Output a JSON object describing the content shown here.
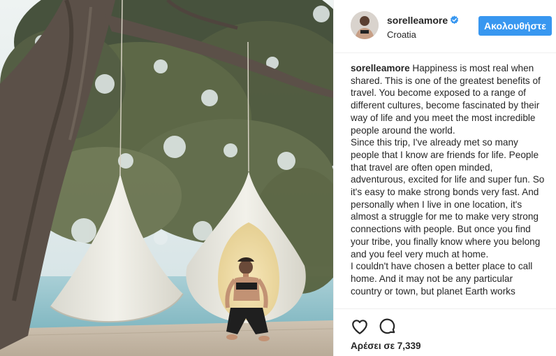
{
  "post": {
    "username": "sorelleamore",
    "location": "Croatia",
    "follow_label": "Ακολουθήστε",
    "caption_username": "sorelleamore",
    "caption_paragraphs": [
      "Happiness is most real when shared. This is one of the greatest benefits of travel. You become exposed to a range of different cultures, become fascinated by their way of life and you meet the most incredible people around the world.",
      "Since this trip, I've already met so many people that I know are friends for life. People that travel are often open minded, adventurous, excited for life and super fun. So it's easy to make strong bonds very fast. And personally when I live in one location, it's almost a struggle for me to make very strong connections with people. But once you find your tribe, you finally know where you belong and you feel very much at home.",
      "I couldn't have chosen a better place to call home. And it may not be any particular country or town, but planet Earth works"
    ],
    "likes_text": "Αρέσει σε 7,339"
  },
  "icons": {
    "verified": "verified-badge-icon",
    "like": "heart-icon",
    "comment": "comment-bubble-icon"
  },
  "colors": {
    "follow_button": "#3897f0",
    "verified_badge": "#3897f0",
    "text": "#262626",
    "divider": "#efefef"
  }
}
